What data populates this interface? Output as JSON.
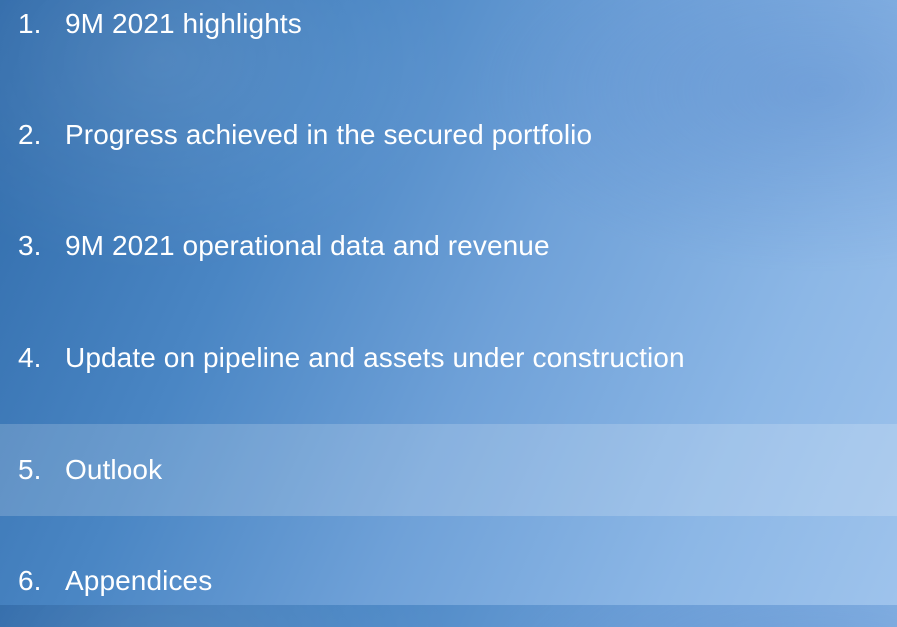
{
  "agenda": {
    "items": [
      {
        "number": "1.",
        "label": "9M 2021 highlights"
      },
      {
        "number": "2.",
        "label": "Progress achieved in the secured portfolio"
      },
      {
        "number": "3.",
        "label": "9M 2021 operational data and revenue"
      },
      {
        "number": "4.",
        "label": "Update on pipeline and assets under construction"
      },
      {
        "number": "5.",
        "label": "Outlook"
      },
      {
        "number": "6.",
        "label": "Appendices"
      }
    ],
    "active_item": "5."
  },
  "colors": {
    "background_dark": "#2f6aa9",
    "background_light": "#9ec3ec",
    "text": "#ffffff",
    "highlight": "rgba(255,255,255,0.18)"
  }
}
